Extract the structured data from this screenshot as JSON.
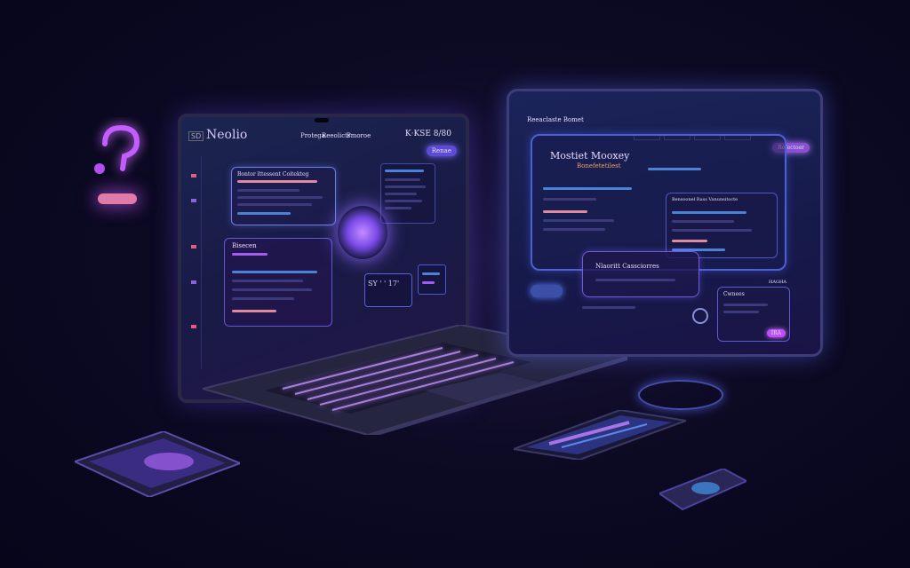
{
  "laptop": {
    "app_title": "Neolio",
    "logo_badge": "SD",
    "nav": [
      "Protega",
      "Reeolicts",
      "Pmoroe"
    ],
    "top_right": "K·KSE 8/80",
    "cta": "Renae",
    "card1_title": "Bontor ïttessent Coitekteg",
    "card2_title": "Bisecen",
    "readout": "SY ' ' 17'"
  },
  "monitor": {
    "brand": "Reeaclaste Bomet",
    "panel_title": "Mostiet Mooxey",
    "panel_sub": "Bonefetetilest",
    "card_title": "Bensoonel Rass Vanunsitocte",
    "bubble_title": "Nlaoritt Cassciorres",
    "badge": "HAGHA",
    "corner": "Cwnees",
    "small_btn": "Rofectoer",
    "action_pill": "IRA"
  }
}
